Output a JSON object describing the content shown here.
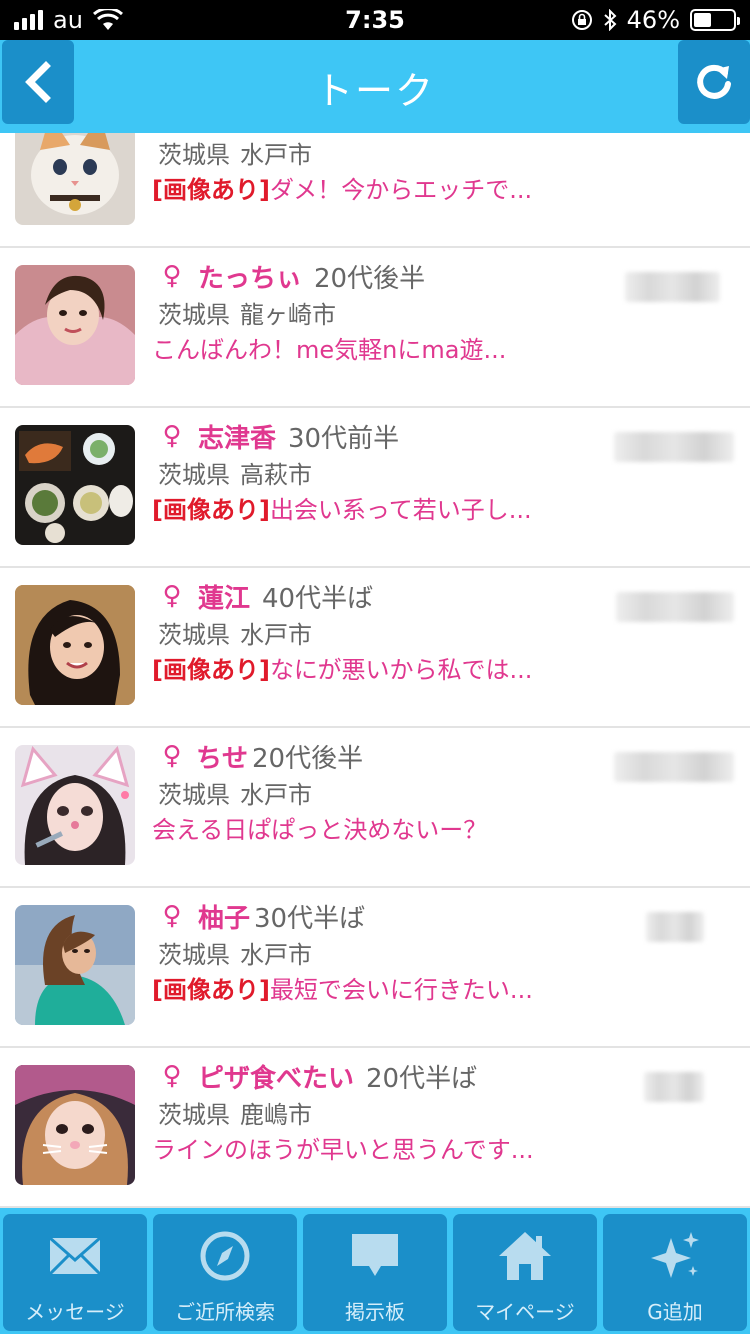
{
  "status_bar": {
    "carrier": "au",
    "time": "7:35",
    "battery_percent": "46%",
    "battery_level": 0.46
  },
  "nav": {
    "title": "トーク",
    "back_icon": "chevron-left-icon",
    "refresh_icon": "refresh-icon"
  },
  "colors": {
    "nav_bg": "#3ec6f5",
    "button_bg": "#1b8fc9",
    "pink": "#e0388f",
    "red": "#e01a2b"
  },
  "messages": [
    {
      "gender": "",
      "name": "",
      "age": "",
      "prefecture": "茨城県",
      "city": "水戸市",
      "image_tag": "[画像あり]",
      "preview": "ダメ！今からエッチで..."
    },
    {
      "gender": "♀",
      "name": "たっちぃ",
      "age": "20代後半",
      "prefecture": "茨城県",
      "city": "龍ヶ崎市",
      "image_tag": "",
      "preview": "こんばんわ！me気軽nにma遊..."
    },
    {
      "gender": "♀",
      "name": "志津香",
      "age": "30代前半",
      "prefecture": "茨城県",
      "city": "高萩市",
      "image_tag": "[画像あり]",
      "preview": "出会い系って若い子し..."
    },
    {
      "gender": "♀",
      "name": "蓮江",
      "age": "40代半ば",
      "prefecture": "茨城県",
      "city": "水戸市",
      "image_tag": "[画像あり]",
      "preview": "なにが悪いから私では..."
    },
    {
      "gender": "♀",
      "name": "ちせ",
      "age": "20代後半",
      "prefecture": "茨城県",
      "city": "水戸市",
      "image_tag": "",
      "preview": "会える日ぱぱっと決めないー？"
    },
    {
      "gender": "♀",
      "name": "柚子",
      "age": "30代半ば",
      "prefecture": "茨城県",
      "city": "水戸市",
      "image_tag": "[画像あり]",
      "preview": "最短で会いに行きたい..."
    },
    {
      "gender": "♀",
      "name": "ピザ食べたい",
      "age": "20代半ば",
      "prefecture": "茨城県",
      "city": "鹿嶋市",
      "image_tag": "",
      "preview": "ラインのほうが早いと思うんです..."
    }
  ],
  "tabs": [
    {
      "label": "メッセージ",
      "icon": "envelope-icon"
    },
    {
      "label": "ご近所検索",
      "icon": "compass-icon"
    },
    {
      "label": "掲示板",
      "icon": "speech-bubble-icon"
    },
    {
      "label": "マイページ",
      "icon": "home-icon"
    },
    {
      "label": "G追加",
      "icon": "sparkle-icon"
    }
  ]
}
